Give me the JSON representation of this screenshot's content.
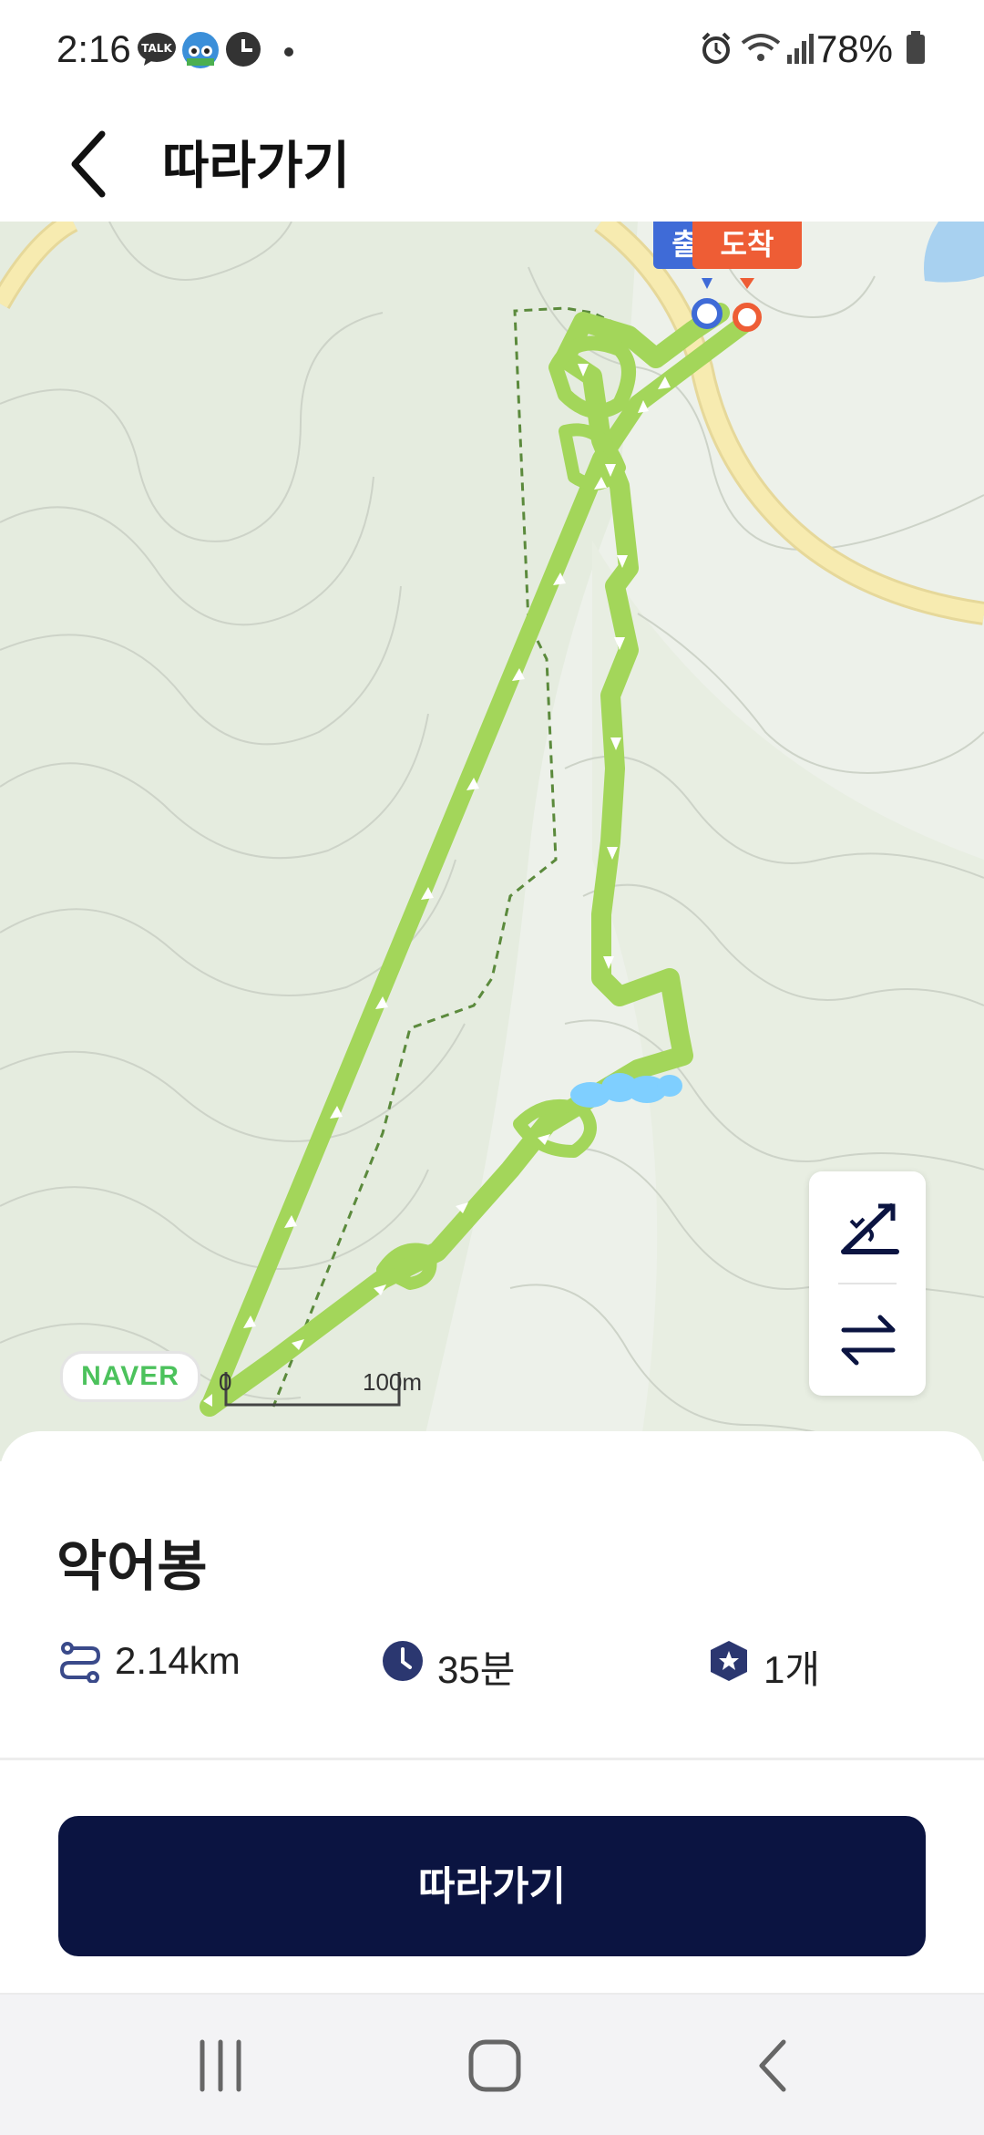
{
  "status_bar": {
    "time": "2:16",
    "battery": "78%",
    "icons": [
      "talk-icon",
      "app-badge-icon",
      "clock-app-icon",
      "dot-icon",
      "alarm-icon",
      "wifi-icon",
      "signal-icon",
      "battery-icon"
    ]
  },
  "app_bar": {
    "title": "따라가기",
    "back_icon": "back-arrow-icon"
  },
  "map": {
    "start_pin_label": "출",
    "end_pin_label": "도착",
    "logo": "NAVER",
    "scale": {
      "left": "0",
      "right": "100m"
    },
    "tools": [
      "elevation-icon",
      "swap-direction-icon"
    ],
    "colors": {
      "route": "#a3d65a",
      "water": "#7fcfff",
      "road": "#f7e8a8",
      "trail": "#5b8a3c"
    }
  },
  "course": {
    "name": "악어봉",
    "distance": "2.14km",
    "duration": "35분",
    "badges": "1개"
  },
  "cta": {
    "label": "따라가기",
    "color": "#0b1441"
  },
  "nav_bar": {
    "items": [
      "recent-apps-icon",
      "home-icon",
      "back-icon"
    ]
  }
}
